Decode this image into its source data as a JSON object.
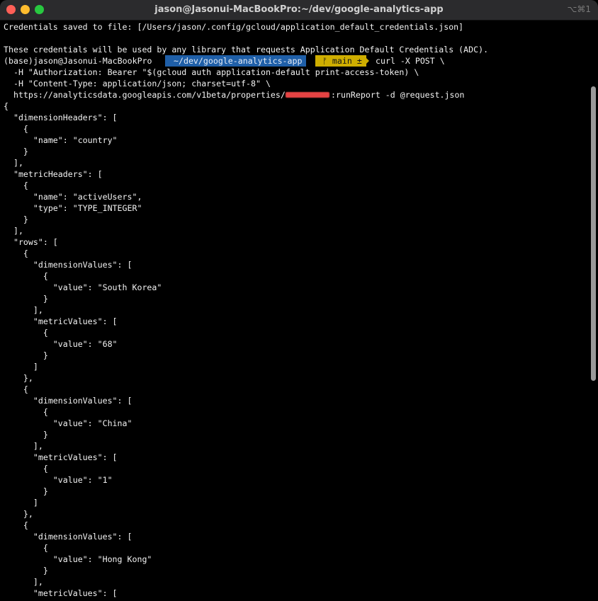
{
  "window": {
    "title": "jason@Jasonui-MacBookPro:~/dev/google-analytics-app",
    "shortcut": "⌥⌘1"
  },
  "prompt": {
    "env": "(base)",
    "user_host": "jason@Jasonui-MacBookPro",
    "dir": "~/dev/google-analytics-app",
    "git": "ᚠ main ±",
    "cmd": "curl -X POST \\"
  },
  "lines": {
    "l1": "Credentials saved to file: [/Users/jason/.config/gcloud/application_default_credentials.json]",
    "l2": "",
    "l3": "These credentials will be used by any library that requests Application Default Credentials (ADC).",
    "l5": "  -H \"Authorization: Bearer \"$(gcloud auth application-default print-access-token) \\",
    "l6": "  -H \"Content-Type: application/json; charset=utf-8\" \\",
    "l7a": "  https://analyticsdata.googleapis.com/v1beta/properties/",
    "l7b": ":runReport -d @request.json",
    "l8": "{",
    "l9": "  \"dimensionHeaders\": [",
    "l10": "    {",
    "l11": "      \"name\": \"country\"",
    "l12": "    }",
    "l13": "  ],",
    "l14": "  \"metricHeaders\": [",
    "l15": "    {",
    "l16": "      \"name\": \"activeUsers\",",
    "l17": "      \"type\": \"TYPE_INTEGER\"",
    "l18": "    }",
    "l19": "  ],",
    "l20": "  \"rows\": [",
    "l21": "    {",
    "l22": "      \"dimensionValues\": [",
    "l23": "        {",
    "l24": "          \"value\": \"South Korea\"",
    "l25": "        }",
    "l26": "      ],",
    "l27": "      \"metricValues\": [",
    "l28": "        {",
    "l29": "          \"value\": \"68\"",
    "l30": "        }",
    "l31": "      ]",
    "l32": "    },",
    "l33": "    {",
    "l34": "      \"dimensionValues\": [",
    "l35": "        {",
    "l36": "          \"value\": \"China\"",
    "l37": "        }",
    "l38": "      ],",
    "l39": "      \"metricValues\": [",
    "l40": "        {",
    "l41": "          \"value\": \"1\"",
    "l42": "        }",
    "l43": "      ]",
    "l44": "    },",
    "l45": "    {",
    "l46": "      \"dimensionValues\": [",
    "l47": "        {",
    "l48": "          \"value\": \"Hong Kong\"",
    "l49": "        }",
    "l50": "      ],",
    "l51": "      \"metricValues\": ["
  },
  "colors": {
    "dir_bg": "#1f5fa8",
    "git_bg": "#cfae00",
    "redaction": "#ff4b4b"
  }
}
